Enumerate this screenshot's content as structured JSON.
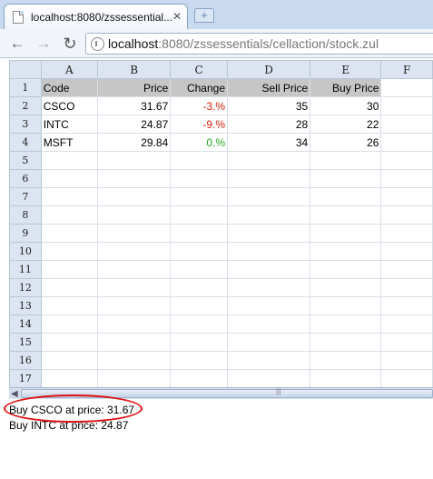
{
  "browser": {
    "tab_title": "localhost:8080/zssessential...",
    "url_host": "localhost",
    "url_rest": ":8080/zssessentials/cellaction/stock.zul"
  },
  "sheet": {
    "columns": [
      "A",
      "B",
      "C",
      "D",
      "E",
      "F"
    ],
    "row_numbers": [
      "1",
      "2",
      "3",
      "4",
      "5",
      "6",
      "7",
      "8",
      "9",
      "10",
      "11",
      "12",
      "13",
      "14",
      "15",
      "16",
      "17"
    ],
    "header": [
      "Code",
      "Price",
      "Change",
      "Sell Price",
      "Buy Price"
    ],
    "rows": [
      [
        "CSCO",
        "31.67",
        "-3.%",
        "35",
        "30"
      ],
      [
        "INTC",
        "24.87",
        "-9.%",
        "28",
        "22"
      ],
      [
        "MSFT",
        "29.84",
        "0.%",
        "34",
        "26"
      ]
    ]
  },
  "log": [
    "Buy CSCO at price: 31.67",
    "Buy INTC at price: 24.87"
  ],
  "colors": {
    "negative_change": "#dd2211",
    "positive_change": "#22aa22",
    "highlight_ellipse": "#dd1111"
  }
}
